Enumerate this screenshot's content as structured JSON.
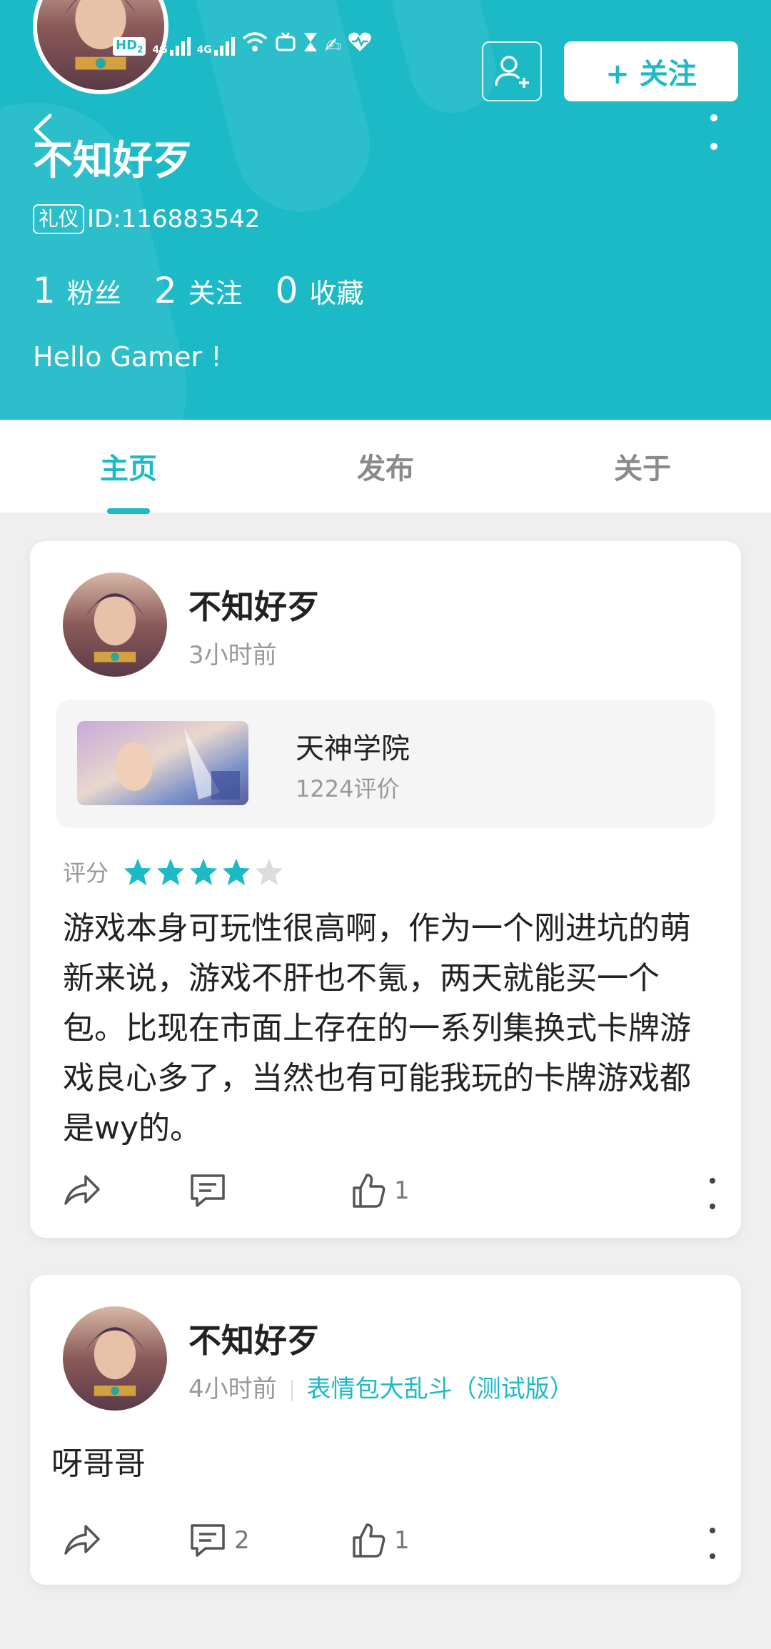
{
  "status_bar": {
    "hd": "HD",
    "hd_sub": "2",
    "net1": "4G",
    "net2": "4G"
  },
  "header": {
    "username": "不知好歹",
    "badge": "礼仪",
    "id_text": "ID:116883542",
    "follow_label": "+ 关注",
    "bio": "Hello Gamer !",
    "stats": [
      {
        "num": "1",
        "label": "粉丝"
      },
      {
        "num": "2",
        "label": "关注"
      },
      {
        "num": "0",
        "label": "收藏"
      }
    ],
    "accent_color": "#1cbac6"
  },
  "tabs": [
    {
      "label": "主页",
      "active": true
    },
    {
      "label": "发布",
      "active": false
    },
    {
      "label": "关于",
      "active": false
    }
  ],
  "posts": [
    {
      "author": "不知好歹",
      "time": "3小时前",
      "game": {
        "title": "天神学院",
        "reviews": "1224评价"
      },
      "rating_label": "评分",
      "rating": 4,
      "rating_max": 5,
      "text": "游戏本身可玩性很高啊，作为一个刚进坑的萌新来说，游戏不肝也不氪，两天就能买一个包。比现在市面上存在的一系列集换式卡牌游戏良心多了，当然也有可能我玩的卡牌游戏都是wy的。",
      "actions": {
        "share": "",
        "comment": "",
        "like": "1"
      }
    },
    {
      "author": "不知好歹",
      "time": "4小时前",
      "game_link": "表情包大乱斗（测试版）",
      "text": "呀哥哥",
      "actions": {
        "share": "",
        "comment": "2",
        "like": "1"
      }
    }
  ]
}
